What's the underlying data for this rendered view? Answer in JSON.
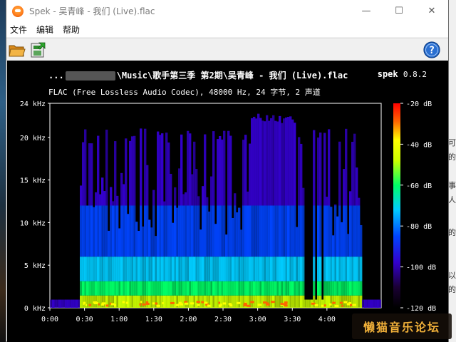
{
  "window": {
    "title": "Spek - 吴青峰 - 我们 (Live).flac",
    "controls": {
      "minimize": "—",
      "maximize": "☐",
      "close": "✕"
    }
  },
  "menu": {
    "items": [
      "文件",
      "编辑",
      "帮助"
    ]
  },
  "toolbar": {
    "buttons": [
      {
        "name": "open-file",
        "icon": "folder-icon"
      },
      {
        "name": "save-image",
        "icon": "save-icon"
      },
      {
        "name": "help",
        "icon": "help-icon"
      }
    ]
  },
  "spek": {
    "file_prefix": "...",
    "file_path": "\\Music\\歌手第三季 第2期\\吴青峰 - 我们 (Live).flac",
    "app_name": "spek",
    "app_version": "0.8.2",
    "codec_info": "FLAC (Free Lossless Audio Codec), 48000 Hz, 24 字节, 2 声道"
  },
  "chart_data": {
    "type": "heatmap",
    "title": "",
    "xlabel": "",
    "ylabel": "",
    "x_ticks": [
      "0:00",
      "0:30",
      "1:00",
      "1:30",
      "2:00",
      "2:30",
      "3:00",
      "3:30",
      "4:00"
    ],
    "y_ticks": [
      "0 kHz",
      "5 kHz",
      "10 kHz",
      "15 kHz",
      "20 kHz",
      "24 kHz"
    ],
    "y_range_khz": [
      0,
      24
    ],
    "x_range_seconds": [
      0,
      287
    ],
    "colorbar_ticks": [
      "-20 dB",
      "-40 dB",
      "-60 dB",
      "-80 dB",
      "-100 dB",
      "-120 dB"
    ],
    "colorbar_range_db": [
      -120,
      -20
    ],
    "colors": [
      "#000000",
      "#1a0033",
      "#3300cc",
      "#0066ff",
      "#00ccff",
      "#00ff66",
      "#ccff00",
      "#ffff00",
      "#ff6600",
      "#ff0000"
    ]
  },
  "desktop": {
    "right_chars": [
      "可",
      "的",
      "事",
      "人",
      "的",
      "以",
      "的"
    ]
  },
  "watermark": {
    "text": "懒猫音乐论坛"
  }
}
